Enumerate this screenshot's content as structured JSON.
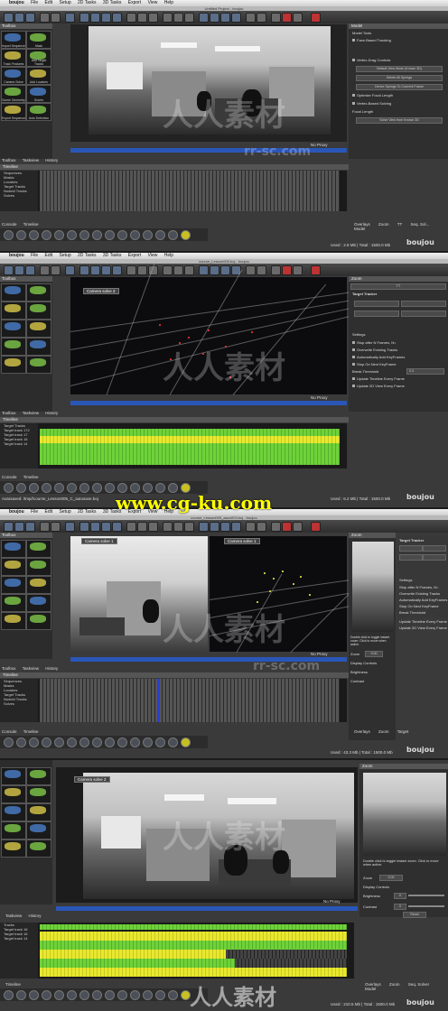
{
  "menubar": {
    "app": "boujou",
    "items": [
      "File",
      "Edit",
      "Setup",
      "2D Tasks",
      "3D Tasks",
      "Export",
      "View",
      "Help"
    ]
  },
  "panels": [
    {
      "title": "Untitled Project - boujou",
      "sidebar_header": "Toolbox",
      "tools": [
        "Import Sequence",
        "Mask",
        "Track Features",
        "Add Target Tracks",
        "Camera Solve",
        "Add Locators",
        "Scene Geometry",
        "Solves",
        "Export Sequence",
        "Auto Detection"
      ],
      "right_header": "Model",
      "right_rows": [
        "Model Tools",
        "Face-Based Tracking",
        "Vertex-Drag Controls",
        "Default View Mode (Known 3D)",
        "Delete All Springs",
        "Derive Springs To Currrent Frame",
        "Optimize Focal Length",
        "Vertex-Based Solving",
        "Focal Length",
        "Solve View from Known 3D"
      ],
      "proxy": "No Proxy",
      "left_tabs": [
        "Toolbox",
        "Taskview",
        "History"
      ],
      "timeline_header": "Timeline",
      "timeline_rows": [
        "Sequences",
        "Masks",
        "Locators",
        "Target Tracks",
        "Nodeld Tracks",
        "Solves"
      ],
      "bottom_left": [
        "Console",
        "Timeline"
      ],
      "bottom_right": [
        "Overlays",
        "Zoom",
        "TT",
        "Seq. Sol...",
        "Model"
      ],
      "status": "Used : 2.8 Mb",
      "total": "Total : 1500.0 Mb"
    },
    {
      "title": "course_Lesson005.boj - boujou",
      "sidebar_header": "Toolbox",
      "camera_label": "Camera solve 2",
      "right_header": "Zoom",
      "right_sub": "TT",
      "right_title": "Target Tracker",
      "right_rows": [
        "Settings",
        "Stop after N Frames, N=",
        "Overwrite Existing Tracks",
        "Automatically Add KeyFrames",
        "Stop On Next KeyFrame",
        "Break Threshold",
        "Update Timeline Every Frame",
        "Update 2D View Every Frame"
      ],
      "threshold": "0.3",
      "proxy": "No Proxy",
      "left_tabs": [
        "Toolbox",
        "Taskview",
        "History"
      ],
      "timeline_header": "Timeline",
      "timeline_rows": [
        "Target Tracks",
        "Target track 172",
        "Target track 17",
        "Target track 16",
        "Target track 14"
      ],
      "bottom_left": [
        "Console",
        "Timeline"
      ],
      "status_path": "Autosaved: /tmp//course_Lesson005_C_autosave.boj",
      "status": "Used : 6.2 Mb",
      "total": "Total : 1500.0 Mb"
    },
    {
      "title": "course_Lesson005_aaco003.boj - boujou",
      "sidebar_header": "Toolbox",
      "camera_label": "Camera solve 1",
      "camera_label2": "Camera solve 1",
      "right_header": "Zoom",
      "right_title": "Target Tracker",
      "right_rows": [
        "Settings",
        "Stop after N Frames, N=",
        "Overwrite Existing Tracks",
        "Automatically Add KeyFrames",
        "Stop On Next KeyFrame",
        "Break Threshold",
        "Update Timeline Every Frame",
        "Update 2D View Every Frame"
      ],
      "zoom_hint": "Double click to toggle instant zoom. Click to move when active.",
      "zoom_label": "Zoom",
      "zoom_value": "3.00",
      "display_controls": "Display Controls",
      "brightness": "Brightness",
      "contrast": "Contrast",
      "proxy": "No Proxy",
      "left_tabs": [
        "Toolbox",
        "Taskview",
        "History"
      ],
      "timeline_header": "Timeline",
      "timeline_rows": [
        "Sequences",
        "Masks",
        "Locators",
        "Target Tracks",
        "Nodeld Tracks",
        "Solves"
      ],
      "bottom_left": [
        "Console",
        "Timeline"
      ],
      "bottom_right": [
        "Overlays",
        "Zoom",
        "Target"
      ],
      "status": "Used : 43.3 Mb",
      "total": "Total : 1500.0 Mb"
    },
    {
      "camera_label": "Camera solve 2",
      "right_header": "Zoom",
      "zoom_hint": "Double click to toggle instant zoom. Click to move when active.",
      "zoom_label": "Zoom",
      "zoom_value": "3.00",
      "display_controls": "Display Controls",
      "brightness": "Brightness",
      "brightness_value": "0",
      "contrast": "Contrast",
      "contrast_value": "0",
      "reset": "Reset",
      "proxy": "No Proxy",
      "left_tabs": [
        "Taskview",
        "History"
      ],
      "timeline_rows": [
        "Tracks",
        "Target track 16",
        "Target track 16",
        "Target track 14"
      ],
      "bottom_left": [
        "Timeline"
      ],
      "bottom_right": [
        "Overlays",
        "Zoom",
        "Seq. Solver",
        "Model"
      ],
      "status": "Used : 210.5 Mb",
      "total": "Total : 1500.0 Mb"
    }
  ],
  "watermarks": {
    "cn": "人人素材",
    "url": "www.cg-ku.com",
    "rr": "rr-sc.com"
  }
}
